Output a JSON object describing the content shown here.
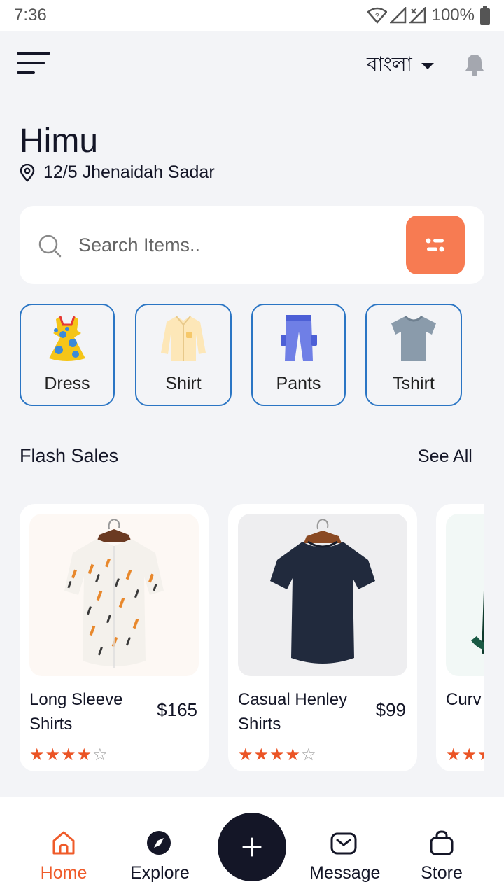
{
  "status_bar": {
    "time": "7:36",
    "battery": "100%"
  },
  "header": {
    "language": "বাংলা"
  },
  "user": {
    "name": "Himu",
    "address": "12/5 Jhenaidah Sadar"
  },
  "search": {
    "placeholder": "Search Items.."
  },
  "categories": [
    {
      "label": "Dress",
      "icon": "dress-icon"
    },
    {
      "label": "Shirt",
      "icon": "shirt-icon"
    },
    {
      "label": "Pants",
      "icon": "pants-icon"
    },
    {
      "label": "Tshirt",
      "icon": "tshirt-icon"
    }
  ],
  "flash_sales": {
    "title": "Flash Sales",
    "see_all": "See All",
    "products": [
      {
        "name": "Long Sleeve Shirts",
        "price": "$165",
        "rating": 4,
        "max_rating": 5
      },
      {
        "name": "Casual Henley Shirts",
        "price": "$99",
        "rating": 4,
        "max_rating": 5
      },
      {
        "name": "Curv Shirt",
        "price": "",
        "rating": 3,
        "max_rating": 5
      }
    ]
  },
  "bottom_nav": {
    "home": "Home",
    "explore": "Explore",
    "message": "Message",
    "store": "Store"
  },
  "colors": {
    "accent": "#f77b52",
    "active_nav": "#ef5b2a",
    "category_border": "#2a75c4",
    "dark": "#141627",
    "star": "#eb5425"
  }
}
